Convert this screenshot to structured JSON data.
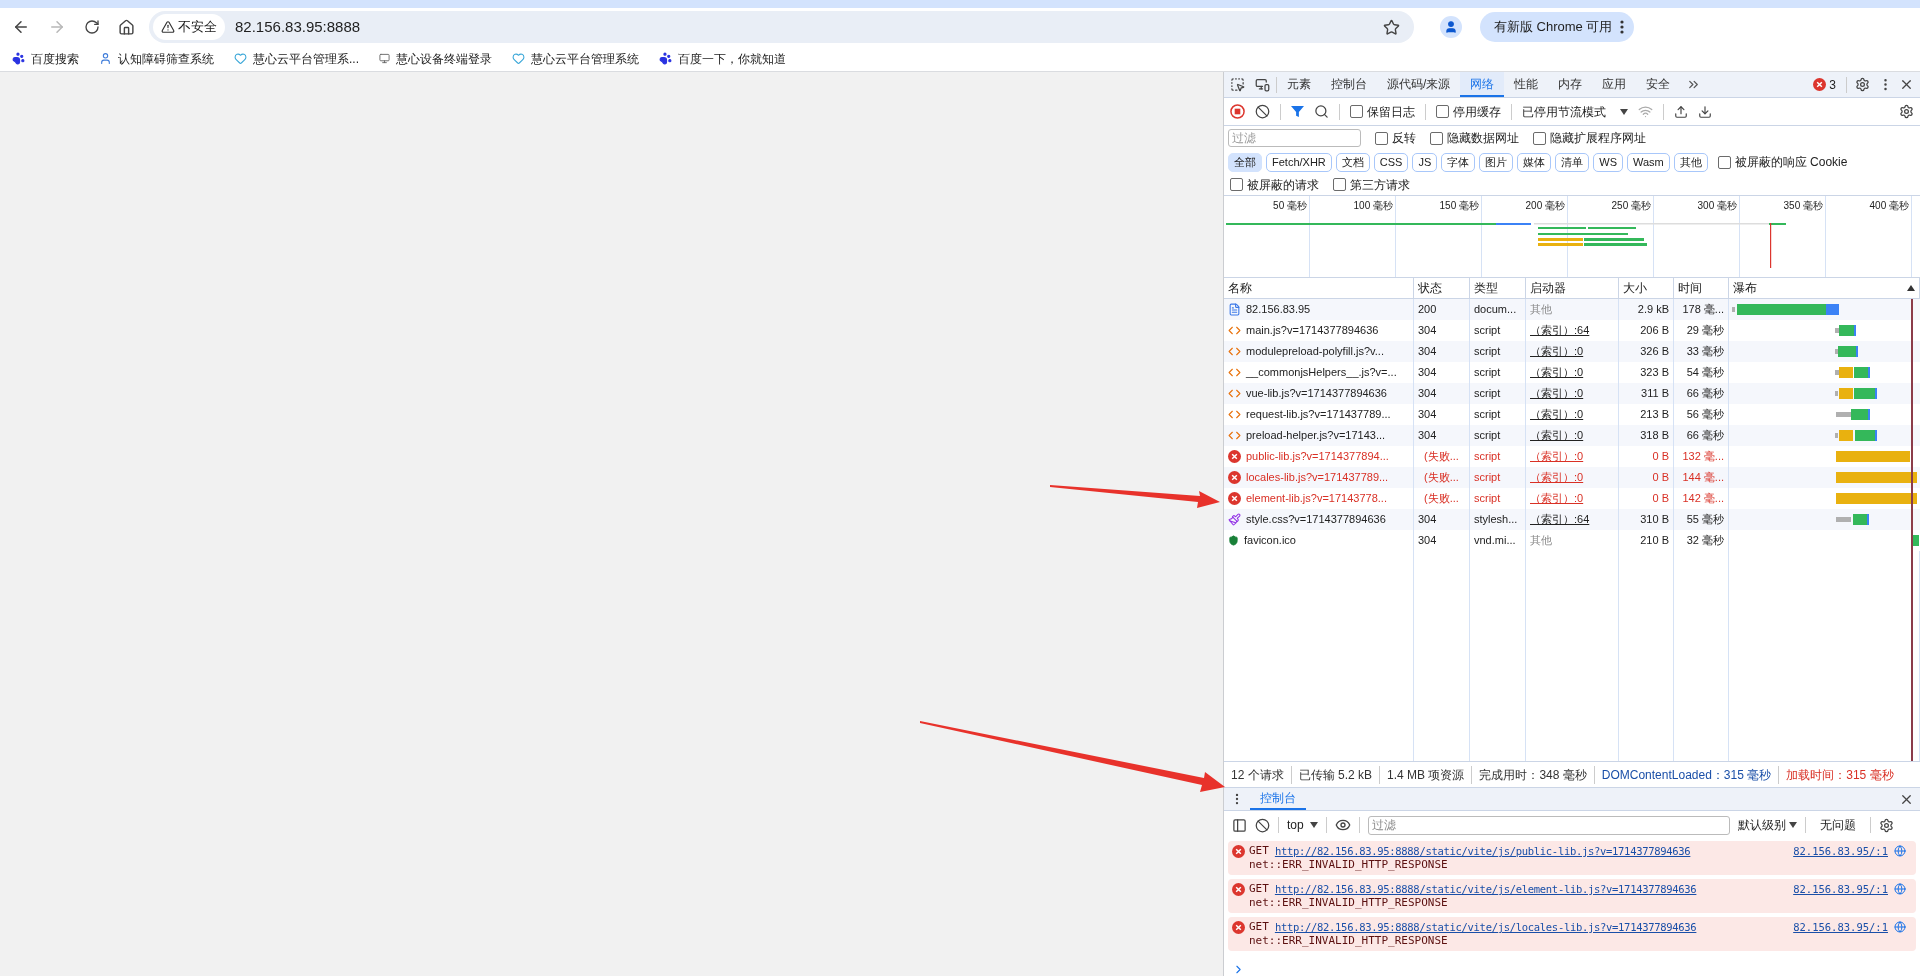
{
  "browser": {
    "forward_disabled": true,
    "security_label": "不安全",
    "url": "82.156.83.95:8888",
    "update_button": "有新版 Chrome 可用"
  },
  "bookmarks": [
    {
      "label": "百度搜索",
      "kind": "paw"
    },
    {
      "label": "认知障碍筛查系统",
      "kind": "person"
    },
    {
      "label": "慧心云平台管理系...",
      "kind": "heart"
    },
    {
      "label": "慧心设备终端登录",
      "kind": "device"
    },
    {
      "label": "慧心云平台管理系统",
      "kind": "heart"
    },
    {
      "label": "百度一下，你就知道",
      "kind": "paw"
    }
  ],
  "devtools": {
    "tabs": [
      {
        "label": "元素",
        "selected": false
      },
      {
        "label": "控制台",
        "selected": false
      },
      {
        "label": "源代码/来源",
        "selected": false
      },
      {
        "label": "网络",
        "selected": true
      },
      {
        "label": "性能",
        "selected": false
      },
      {
        "label": "内存",
        "selected": false
      },
      {
        "label": "应用",
        "selected": false
      },
      {
        "label": "安全",
        "selected": false
      }
    ],
    "error_count": "3",
    "toolbar": {
      "recording": true,
      "checkboxes": [
        {
          "label": "保留日志",
          "checked": false
        },
        {
          "label": "停用缓存",
          "checked": false
        }
      ],
      "throttling": "已停用节流模式"
    },
    "filter": {
      "placeholder": "过滤",
      "checkboxes": [
        {
          "label": "反转",
          "checked": false
        },
        {
          "label": "隐藏数据网址",
          "checked": false
        },
        {
          "label": "隐藏扩展程序网址",
          "checked": false
        }
      ]
    },
    "type_filters": [
      {
        "label": "全部",
        "selected": true
      },
      {
        "label": "Fetch/XHR",
        "selected": false
      },
      {
        "label": "文档",
        "selected": false
      },
      {
        "label": "CSS",
        "selected": false
      },
      {
        "label": "JS",
        "selected": false
      },
      {
        "label": "字体",
        "selected": false
      },
      {
        "label": "图片",
        "selected": false
      },
      {
        "label": "媒体",
        "selected": false
      },
      {
        "label": "清单",
        "selected": false
      },
      {
        "label": "WS",
        "selected": false
      },
      {
        "label": "Wasm",
        "selected": false
      },
      {
        "label": "其他",
        "selected": false
      }
    ],
    "blocked_cookies": {
      "label": "被屏蔽的响应 Cookie",
      "checked": false
    },
    "request_checkboxes": [
      {
        "label": "被屏蔽的请求",
        "checked": false
      },
      {
        "label": "第三方请求",
        "checked": false
      }
    ],
    "overview_ticks": [
      "50 毫秒",
      "100 毫秒",
      "150 毫秒",
      "200 毫秒",
      "250 毫秒",
      "300 毫秒",
      "350 毫秒",
      "400 毫秒"
    ],
    "table": {
      "columns": [
        "名称",
        "状态",
        "类型",
        "启动器",
        "大小",
        "时间",
        "瀑布"
      ],
      "rows": [
        {
          "kind": "document",
          "failed": false,
          "name": "82.156.83.95",
          "status": "200",
          "type": "docum...",
          "initiator": "其他",
          "initiator_link": false,
          "size": "2.9 kB",
          "time": "178 毫..."
        },
        {
          "kind": "script",
          "failed": false,
          "name": "main.js?v=1714377894636",
          "status": "304",
          "type": "script",
          "initiator": "（索引）:64",
          "initiator_link": true,
          "size": "206 B",
          "time": "29 毫秒"
        },
        {
          "kind": "script",
          "failed": false,
          "name": "modulepreload-polyfill.js?v...",
          "status": "304",
          "type": "script",
          "initiator": "（索引）:0",
          "initiator_link": true,
          "size": "326 B",
          "time": "33 毫秒"
        },
        {
          "kind": "script",
          "failed": false,
          "name": "__commonjsHelpers__.js?v=...",
          "status": "304",
          "type": "script",
          "initiator": "（索引）:0",
          "initiator_link": true,
          "size": "323 B",
          "time": "54 毫秒"
        },
        {
          "kind": "script",
          "failed": false,
          "name": "vue-lib.js?v=1714377894636",
          "status": "304",
          "type": "script",
          "initiator": "（索引）:0",
          "initiator_link": true,
          "size": "311 B",
          "time": "66 毫秒"
        },
        {
          "kind": "script",
          "failed": false,
          "name": "request-lib.js?v=171437789...",
          "status": "304",
          "type": "script",
          "initiator": "（索引）:0",
          "initiator_link": true,
          "size": "213 B",
          "time": "56 毫秒"
        },
        {
          "kind": "script",
          "failed": false,
          "name": "preload-helper.js?v=17143...",
          "status": "304",
          "type": "script",
          "initiator": "（索引）:0",
          "initiator_link": true,
          "size": "318 B",
          "time": "66 毫秒"
        },
        {
          "kind": "script",
          "failed": true,
          "name": "public-lib.js?v=1714377894...",
          "status": "(失败...",
          "type": "script",
          "initiator": "（索引）:0",
          "initiator_link": true,
          "size": "0 B",
          "time": "132 毫..."
        },
        {
          "kind": "script",
          "failed": true,
          "name": "locales-lib.js?v=171437789...",
          "status": "(失败...",
          "type": "script",
          "initiator": "（索引）:0",
          "initiator_link": true,
          "size": "0 B",
          "time": "144 毫..."
        },
        {
          "kind": "script",
          "failed": true,
          "name": "element-lib.js?v=17143778...",
          "status": "(失败...",
          "type": "script",
          "initiator": "（索引）:0",
          "initiator_link": true,
          "size": "0 B",
          "time": "142 毫..."
        },
        {
          "kind": "stylesheet",
          "failed": false,
          "name": "style.css?v=1714377894636",
          "status": "304",
          "type": "stylesh...",
          "initiator": "（索引）:64",
          "initiator_link": true,
          "size": "310 B",
          "time": "55 毫秒"
        },
        {
          "kind": "favicon",
          "failed": false,
          "name": "favicon.ico",
          "status": "304",
          "type": "vnd.mi...",
          "initiator": "其他",
          "initiator_link": false,
          "size": "210 B",
          "time": "32 毫秒"
        }
      ]
    },
    "status_bar": [
      {
        "text": "12 个请求",
        "color": "#333333"
      },
      {
        "text": "已传输 5.2 kB",
        "color": "#333333"
      },
      {
        "text": "1.4 MB 项资源",
        "color": "#333333"
      },
      {
        "text": "完成用时：348 毫秒",
        "color": "#333333"
      },
      {
        "text": "DOMContentLoaded：315 毫秒",
        "color": "#1a4fa8"
      },
      {
        "text": "加载时间：315 毫秒",
        "color": "#d93025"
      }
    ],
    "console": {
      "tab": {
        "label": "控制台",
        "selected": true
      },
      "context": "top",
      "filter_placeholder": "过滤",
      "level": "默认级别",
      "issues": "无问题",
      "messages": [
        {
          "method": "GET",
          "url": "http://82.156.83.95:8888/static/vite/js/public-lib.js?v=1714377894636",
          "source": "82.156.83.95/:1",
          "error": "net::ERR_INVALID_HTTP_RESPONSE"
        },
        {
          "method": "GET",
          "url": "http://82.156.83.95:8888/static/vite/js/element-lib.js?v=1714377894636",
          "source": "82.156.83.95/:1",
          "error": "net::ERR_INVALID_HTTP_RESPONSE"
        },
        {
          "method": "GET",
          "url": "http://82.156.83.95:8888/static/vite/js/locales-lib.js?v=1714377894636",
          "source": "82.156.83.95/:1",
          "error": "net::ERR_INVALID_HTTP_RESPONSE"
        }
      ]
    }
  }
}
